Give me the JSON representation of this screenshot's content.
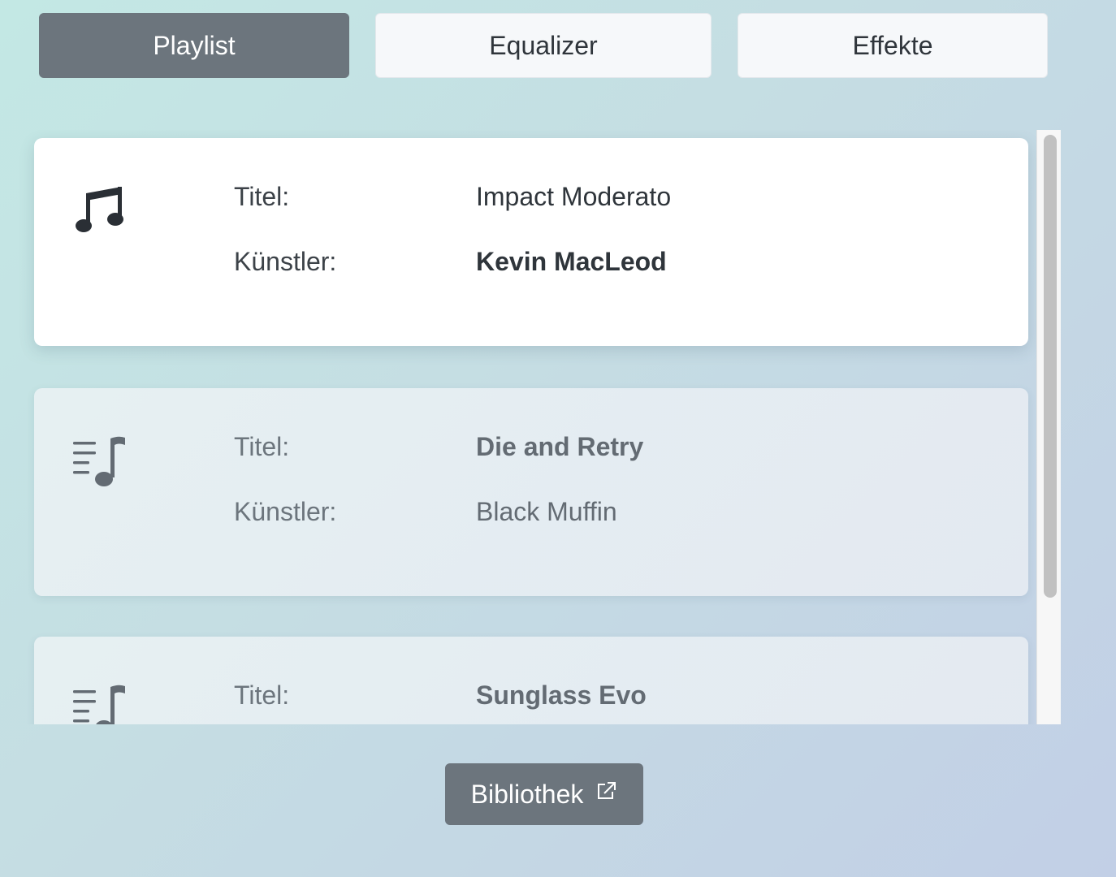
{
  "tabs": [
    {
      "label": "Playlist",
      "active": true
    },
    {
      "label": "Equalizer",
      "active": false
    },
    {
      "label": "Effekte",
      "active": false
    }
  ],
  "playlist": {
    "title_label": "Titel:",
    "artist_label": "Künstler:",
    "items": [
      {
        "icon": "music-note-icon",
        "title": "Impact Moderato",
        "artist": "Kevin MacLeod",
        "state": "current"
      },
      {
        "icon": "playlist-music-icon",
        "title": "Die and Retry",
        "artist": "Black Muffin",
        "state": "queued"
      },
      {
        "icon": "playlist-music-icon",
        "title": "Sunglass Evo",
        "artist": "",
        "state": "queued"
      }
    ]
  },
  "footer": {
    "library_label": "Bibliothek",
    "library_icon": "external-link-icon"
  },
  "colors": {
    "accent": "#6c757d",
    "card_current": "#ffffff",
    "card_queued": "#e5edf1"
  }
}
